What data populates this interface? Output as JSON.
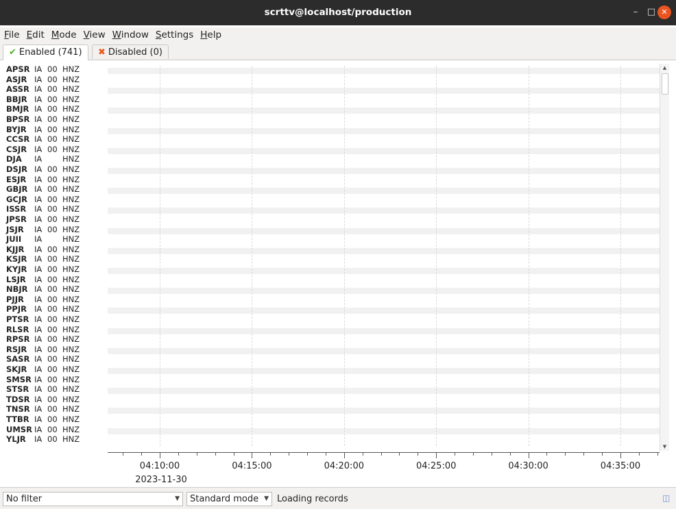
{
  "window": {
    "title": "scrttv@localhost/production"
  },
  "menu": [
    "File",
    "Edit",
    "Mode",
    "View",
    "Window",
    "Settings",
    "Help"
  ],
  "tabs": [
    {
      "label": "Enabled (741)",
      "icon": "check-icon"
    },
    {
      "label": "Disabled (0)",
      "icon": "x-icon"
    }
  ],
  "colors": {
    "enabled_icon": "#4caf2a",
    "disabled_icon": "#e85a1c",
    "close_button": "#e95420"
  },
  "traces": [
    {
      "station": "APSR",
      "network": "IA",
      "location": "00",
      "channel": "HNZ"
    },
    {
      "station": "ASJR",
      "network": "IA",
      "location": "00",
      "channel": "HNZ"
    },
    {
      "station": "ASSR",
      "network": "IA",
      "location": "00",
      "channel": "HNZ"
    },
    {
      "station": "BBJR",
      "network": "IA",
      "location": "00",
      "channel": "HNZ"
    },
    {
      "station": "BMJR",
      "network": "IA",
      "location": "00",
      "channel": "HNZ"
    },
    {
      "station": "BPSR",
      "network": "IA",
      "location": "00",
      "channel": "HNZ"
    },
    {
      "station": "BYJR",
      "network": "IA",
      "location": "00",
      "channel": "HNZ"
    },
    {
      "station": "CCSR",
      "network": "IA",
      "location": "00",
      "channel": "HNZ"
    },
    {
      "station": "CSJR",
      "network": "IA",
      "location": "00",
      "channel": "HNZ"
    },
    {
      "station": "DJA",
      "network": "IA",
      "location": "",
      "channel": "HNZ"
    },
    {
      "station": "DSJR",
      "network": "IA",
      "location": "00",
      "channel": "HNZ"
    },
    {
      "station": "ESJR",
      "network": "IA",
      "location": "00",
      "channel": "HNZ"
    },
    {
      "station": "GBJR",
      "network": "IA",
      "location": "00",
      "channel": "HNZ"
    },
    {
      "station": "GCJR",
      "network": "IA",
      "location": "00",
      "channel": "HNZ"
    },
    {
      "station": "ISSR",
      "network": "IA",
      "location": "00",
      "channel": "HNZ"
    },
    {
      "station": "JPSR",
      "network": "IA",
      "location": "00",
      "channel": "HNZ"
    },
    {
      "station": "JSJR",
      "network": "IA",
      "location": "00",
      "channel": "HNZ"
    },
    {
      "station": "JUII",
      "network": "IA",
      "location": "",
      "channel": "HNZ"
    },
    {
      "station": "KJJR",
      "network": "IA",
      "location": "00",
      "channel": "HNZ"
    },
    {
      "station": "KSJR",
      "network": "IA",
      "location": "00",
      "channel": "HNZ"
    },
    {
      "station": "KYJR",
      "network": "IA",
      "location": "00",
      "channel": "HNZ"
    },
    {
      "station": "LSJR",
      "network": "IA",
      "location": "00",
      "channel": "HNZ"
    },
    {
      "station": "NBJR",
      "network": "IA",
      "location": "00",
      "channel": "HNZ"
    },
    {
      "station": "PJJR",
      "network": "IA",
      "location": "00",
      "channel": "HNZ"
    },
    {
      "station": "PPJR",
      "network": "IA",
      "location": "00",
      "channel": "HNZ"
    },
    {
      "station": "PTSR",
      "network": "IA",
      "location": "00",
      "channel": "HNZ"
    },
    {
      "station": "RLSR",
      "network": "IA",
      "location": "00",
      "channel": "HNZ"
    },
    {
      "station": "RPSR",
      "network": "IA",
      "location": "00",
      "channel": "HNZ"
    },
    {
      "station": "RSJR",
      "network": "IA",
      "location": "00",
      "channel": "HNZ"
    },
    {
      "station": "SASR",
      "network": "IA",
      "location": "00",
      "channel": "HNZ"
    },
    {
      "station": "SKJR",
      "network": "IA",
      "location": "00",
      "channel": "HNZ"
    },
    {
      "station": "SMSR",
      "network": "IA",
      "location": "00",
      "channel": "HNZ"
    },
    {
      "station": "STSR",
      "network": "IA",
      "location": "00",
      "channel": "HNZ"
    },
    {
      "station": "TDSR",
      "network": "IA",
      "location": "00",
      "channel": "HNZ"
    },
    {
      "station": "TNSR",
      "network": "IA",
      "location": "00",
      "channel": "HNZ"
    },
    {
      "station": "TTBR",
      "network": "IA",
      "location": "00",
      "channel": "HNZ"
    },
    {
      "station": "UMSR",
      "network": "IA",
      "location": "00",
      "channel": "HNZ"
    },
    {
      "station": "YLJR",
      "network": "IA",
      "location": "00",
      "channel": "HNZ"
    }
  ],
  "time_axis": {
    "labels": [
      "04:10:00",
      "04:15:00",
      "04:20:00",
      "04:25:00",
      "04:30:00",
      "04:35:00"
    ],
    "date": "2023-11-30"
  },
  "status": {
    "filter": "No filter",
    "mode": "Standard mode",
    "message": "Loading records"
  }
}
